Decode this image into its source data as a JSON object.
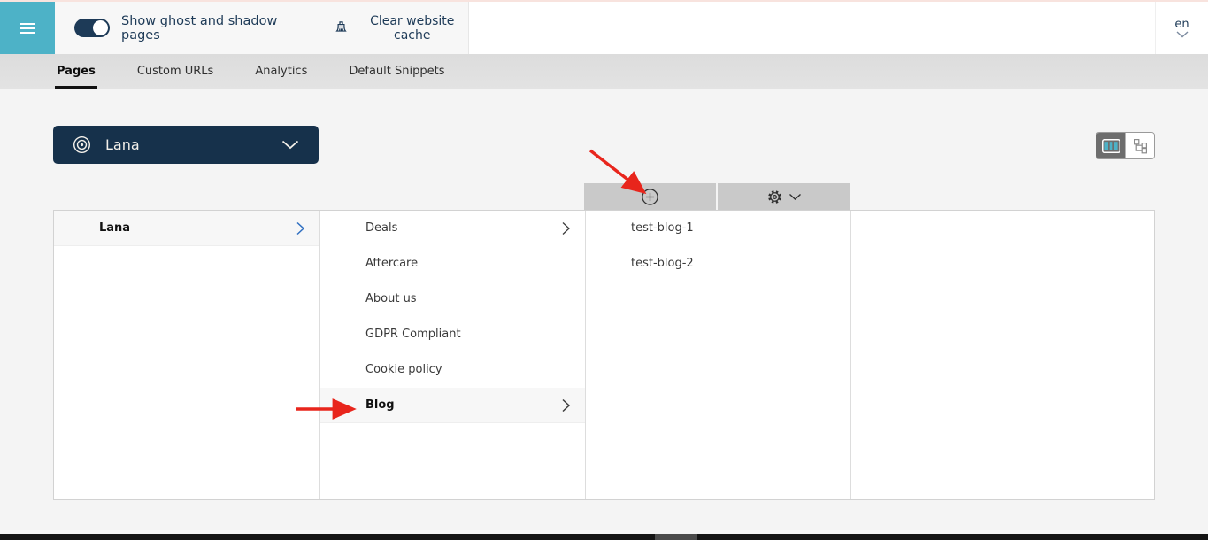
{
  "header": {
    "menu": {
      "icon": "hamburger-icon"
    },
    "toggle": {
      "label": "Show ghost and shadow pages",
      "state": "on"
    },
    "clear_cache": {
      "label": "Clear website cache",
      "icon": "brush-icon"
    },
    "language_selector": {
      "value": "en",
      "icon": "chevron-down-icon"
    }
  },
  "tabs": [
    {
      "label": "Pages",
      "active": true
    },
    {
      "label": "Custom URLs",
      "active": false
    },
    {
      "label": "Analytics",
      "active": false
    },
    {
      "label": "Default Snippets",
      "active": false
    }
  ],
  "site_selector": {
    "label": "Lana",
    "icon": "bullseye-icon",
    "chevron": "chevron-down-icon"
  },
  "view_toggle": {
    "options": [
      {
        "name": "columns-view",
        "active": true
      },
      {
        "name": "tree-view",
        "active": false
      }
    ]
  },
  "column_toolbar": {
    "add_icon": "plus-circle-icon",
    "settings_icon": "gear-icon",
    "settings_chevron": "chevron-down-icon"
  },
  "browser": {
    "columns": [
      {
        "items": [
          {
            "label": "Lana",
            "bold": true,
            "has_children": true,
            "selected": true
          }
        ]
      },
      {
        "items": [
          {
            "label": "Deals",
            "has_children": true
          },
          {
            "label": "Aftercare"
          },
          {
            "label": "About us"
          },
          {
            "label": "GDPR Compliant"
          },
          {
            "label": "Cookie policy"
          },
          {
            "label": "Blog",
            "bold": true,
            "has_children": true,
            "selected": true
          }
        ]
      },
      {
        "items": [
          {
            "label": "test-blog-1"
          },
          {
            "label": "test-blog-2"
          }
        ]
      },
      {
        "items": []
      }
    ]
  },
  "annotations": {
    "color": "#e8251c",
    "arrows": [
      {
        "target": "add-page-button",
        "direction": "down-right"
      },
      {
        "target": "blog-item",
        "direction": "right"
      }
    ]
  },
  "colors": {
    "accent_teal": "#4db2c7",
    "navy_text": "#1d3a57",
    "selector_bg": "#16314b",
    "toolbar_gray": "#c9c9c9",
    "annotation_red": "#e8251c"
  }
}
